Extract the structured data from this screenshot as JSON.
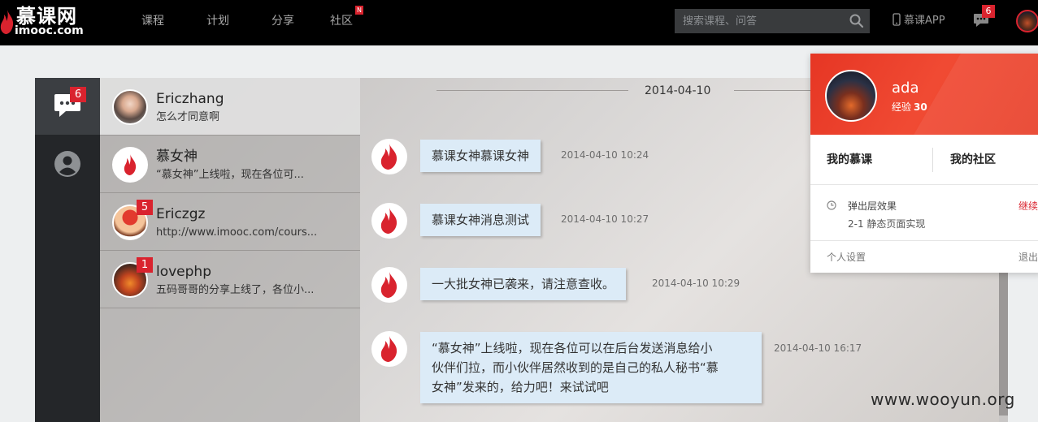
{
  "header": {
    "logo_cn": "慕课网",
    "logo_en": "imooc.com",
    "nav": [
      {
        "label": "课程"
      },
      {
        "label": "计划"
      },
      {
        "label": "分享"
      },
      {
        "label": "社区",
        "badge": "N"
      }
    ],
    "search": {
      "placeholder": "搜索课程、问答",
      "value": ""
    },
    "app_label": "慕课APP",
    "message_count": "6"
  },
  "sidebar": {
    "chat_badge": "6"
  },
  "conversations": [
    {
      "name": "Ericzhang",
      "preview": "怎么才同意啊",
      "badge": ""
    },
    {
      "name": "慕女神",
      "preview": "“慕女神”上线啦，现在各位可...",
      "badge": ""
    },
    {
      "name": "Ericzgz",
      "preview": "http://www.imooc.com/cours...",
      "badge": "5"
    },
    {
      "name": "lovephp",
      "preview": "五码哥哥的分享上线了，各位小...",
      "badge": "1"
    }
  ],
  "chat": {
    "date": "2014-04-10",
    "messages": [
      {
        "text": "慕课女神慕课女神",
        "time": "2014-04-10 10:24"
      },
      {
        "text": "慕课女神消息测试",
        "time": "2014-04-10 10:27"
      },
      {
        "text": "一大批女神已袭来，请注意查收。",
        "time": "2014-04-10 10:29"
      },
      {
        "text_lines": [
          "“慕女神”上线啦，现在各位可以在后台发送消息给小",
          "伙伴们拉，而小伙伴居然收到的是自己的私人秘书“慕",
          "女神”发来的，给力吧！来试试吧"
        ],
        "time": "2014-04-10 16:17"
      }
    ]
  },
  "user_menu": {
    "name": "ada",
    "exp_label": "经验",
    "exp_value": "30",
    "my_courses": "我的慕课",
    "my_community": "我的社区",
    "recent_course": "弹出层效果",
    "recent_chapter": "2-1 静态页面实现",
    "continue": "继续",
    "settings": "个人设置",
    "logout": "退出"
  },
  "watermark": "www.wooyun.org",
  "colors": {
    "brand_red": "#d9232e",
    "bubble": "#dcebf7",
    "nav_bg": "#000000"
  }
}
